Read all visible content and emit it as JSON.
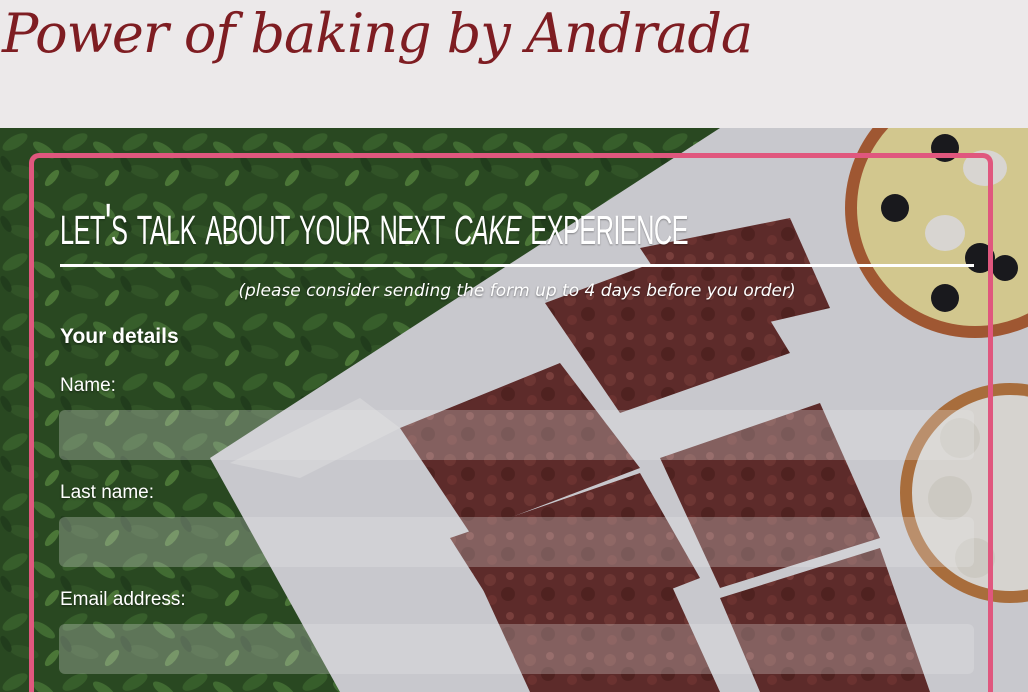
{
  "header": {
    "site_title": "Power of baking by Andrada"
  },
  "form": {
    "heading_part1": "Let's talk about your next ",
    "heading_cake": "cake",
    "heading_part2": " experience",
    "subtitle": "(please consider sending the form up to 4 days before you order)",
    "section_title": "Your details",
    "fields": [
      {
        "label": "Name:",
        "value": ""
      },
      {
        "label": "Last name:",
        "value": ""
      },
      {
        "label": "Email address:",
        "value": ""
      }
    ]
  },
  "colors": {
    "title": "#7e1d22",
    "card_border": "#e0577e",
    "header_bg": "#ece9ea"
  }
}
